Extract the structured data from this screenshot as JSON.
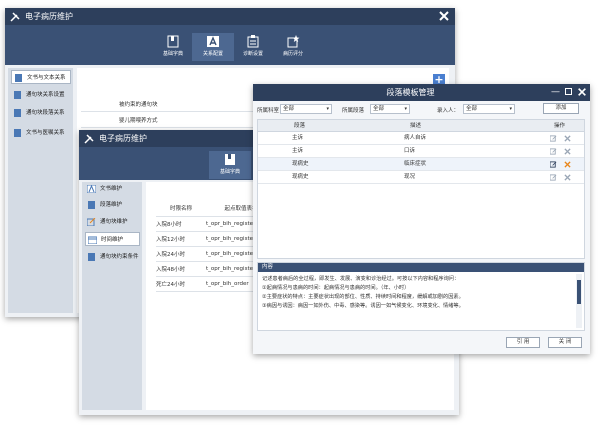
{
  "colors": {
    "title_bar": "#2d3f5c",
    "toolbar": "#3a5175",
    "accent_orange": "#e8851a",
    "sidebar": "#d4dbe4"
  },
  "back_window": {
    "title": "电子病历维护",
    "toolbar": [
      {
        "label": "基础字典",
        "icon": "book-icon"
      },
      {
        "label": "关系配置",
        "icon": "letter-a-icon"
      },
      {
        "label": "诊断设置",
        "icon": "clipboard-icon"
      },
      {
        "label": "病历评分",
        "icon": "star-doc-icon"
      }
    ],
    "sidebar": [
      {
        "label": "文书与文本关系"
      },
      {
        "label": "通句块关系设置"
      },
      {
        "label": "通句块段落关系"
      },
      {
        "label": "文书与医嘱关系"
      }
    ],
    "rows": [
      "被约束的通句块",
      "婴儿期喂养方式"
    ],
    "add_label": "+"
  },
  "mid_window": {
    "title": "电子病历维护",
    "toolbar": [
      {
        "label": "基础字典",
        "icon": "book-icon"
      }
    ],
    "sidebar": [
      {
        "label": "文书维护"
      },
      {
        "label": "段落维护"
      },
      {
        "label": "通句块维护"
      },
      {
        "label": "时间维护"
      },
      {
        "label": "通句块约束条件"
      }
    ],
    "columns": [
      "时限名称",
      "起点取值表名"
    ],
    "rows": [
      [
        "入院8小时",
        "t_opr_bih_register"
      ],
      [
        "入院12小时",
        "t_opr_bih_register"
      ],
      [
        "入院24小时",
        "t_opr_bih_register"
      ],
      [
        "入院48小时",
        "t_opr_bih_register"
      ],
      [
        "死亡24小时",
        "t_opr_bih_order"
      ]
    ]
  },
  "dialog": {
    "title": "段落模板管理",
    "filters": [
      {
        "label": "所属科室",
        "value": "全部"
      },
      {
        "label": "所属段落",
        "value": "全部"
      },
      {
        "label": "录入人：",
        "value": "全部"
      }
    ],
    "add_button": "添加",
    "columns": [
      "段落",
      "描述",
      "操作"
    ],
    "rows": [
      {
        "section": "主诉",
        "desc": "病人自诉"
      },
      {
        "section": "主诉",
        "desc": "口诉"
      },
      {
        "section": "现病史",
        "desc": "临床症状"
      },
      {
        "section": "现病史",
        "desc": "现况"
      }
    ],
    "content_label": "内容",
    "content_lines": [
      "记述患者病后的全过程，即发生、发展、演变和诊治经过。可按以下内容和程序询问：",
      "①起病情况与患病的时间：起病情况与患病的时间。（年、小时）",
      "②主要症状的特点：主要症状出现的部位、性质、持续时间和程度，缓解或加剧的因素。",
      "③病因与诱因：病因一如外伤、中毒、感染等。诱因一如气候变化、环境变化、情绪等。"
    ],
    "ok_button": "引 用",
    "close_button": "关 闭"
  }
}
